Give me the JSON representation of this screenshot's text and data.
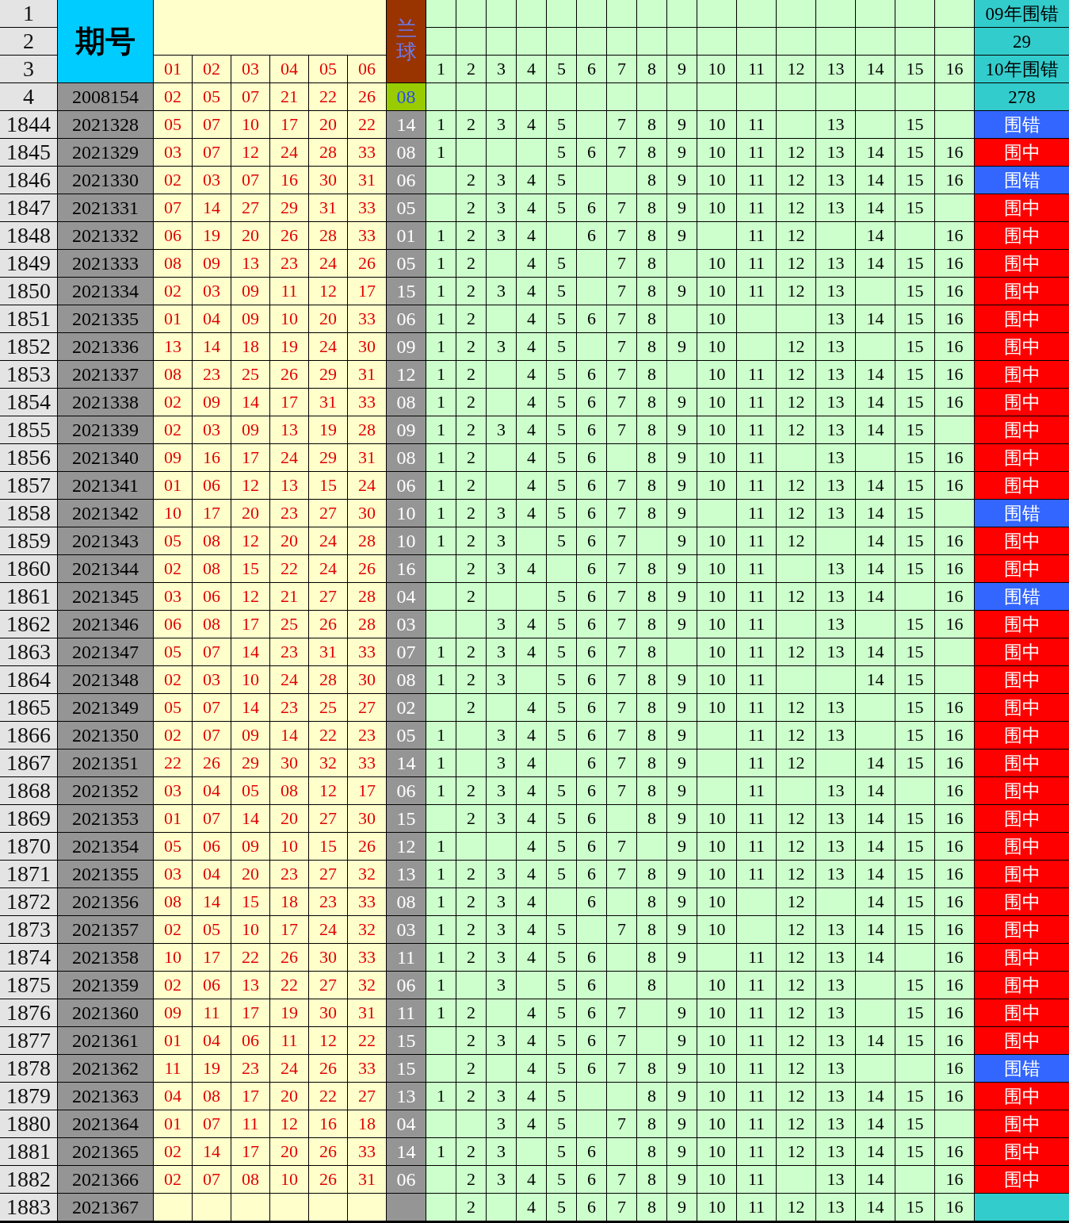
{
  "header": {
    "row_numbers": [
      "1",
      "2",
      "3"
    ],
    "issue_label": "期号",
    "red_columns": [
      "01",
      "02",
      "03",
      "04",
      "05",
      "06"
    ],
    "blue_label": "兰球",
    "number_columns": [
      "1",
      "2",
      "3",
      "4",
      "5",
      "6",
      "7",
      "8",
      "9",
      "10",
      "11",
      "12",
      "13",
      "14",
      "15",
      "16"
    ],
    "summary": [
      "09年围错",
      "29",
      "10年围错"
    ]
  },
  "rows": [
    {
      "kind": "reference",
      "row": "4",
      "issue": "2008154",
      "reds": [
        "02",
        "05",
        "07",
        "21",
        "22",
        "26"
      ],
      "blue": "08",
      "cells": [
        null,
        null,
        null,
        null,
        null,
        null,
        null,
        null,
        null,
        null,
        null,
        null,
        null,
        null,
        null,
        null
      ],
      "result": {
        "text": "278",
        "kind": "count"
      }
    },
    {
      "kind": "draw",
      "row": "1844",
      "issue": "2021328",
      "reds": [
        "05",
        "07",
        "10",
        "17",
        "20",
        "22"
      ],
      "blue": "14",
      "cells": [
        "1",
        "2",
        "3",
        "4",
        "5",
        null,
        "7",
        "8",
        "9",
        "10",
        "11",
        null,
        "13",
        null,
        "15",
        null
      ],
      "result": {
        "text": "围错",
        "kind": "miss"
      }
    },
    {
      "kind": "draw",
      "row": "1845",
      "issue": "2021329",
      "reds": [
        "03",
        "07",
        "12",
        "24",
        "28",
        "33"
      ],
      "blue": "08",
      "cells": [
        "1",
        null,
        null,
        null,
        "5",
        "6",
        "7",
        "8",
        "9",
        "10",
        "11",
        "12",
        "13",
        "14",
        "15",
        "16"
      ],
      "result": {
        "text": "围中",
        "kind": "hit"
      }
    },
    {
      "kind": "draw",
      "row": "1846",
      "issue": "2021330",
      "reds": [
        "02",
        "03",
        "07",
        "16",
        "30",
        "31"
      ],
      "blue": "06",
      "cells": [
        null,
        "2",
        "3",
        "4",
        "5",
        null,
        null,
        "8",
        "9",
        "10",
        "11",
        "12",
        "13",
        "14",
        "15",
        "16"
      ],
      "result": {
        "text": "围错",
        "kind": "miss"
      }
    },
    {
      "kind": "draw",
      "row": "1847",
      "issue": "2021331",
      "reds": [
        "07",
        "14",
        "27",
        "29",
        "31",
        "33"
      ],
      "blue": "05",
      "cells": [
        null,
        "2",
        "3",
        "4",
        "5",
        "6",
        "7",
        "8",
        "9",
        "10",
        "11",
        "12",
        "13",
        "14",
        "15",
        null
      ],
      "result": {
        "text": "围中",
        "kind": "hit"
      }
    },
    {
      "kind": "draw",
      "row": "1848",
      "issue": "2021332",
      "reds": [
        "06",
        "19",
        "20",
        "26",
        "28",
        "33"
      ],
      "blue": "01",
      "cells": [
        "1",
        "2",
        "3",
        "4",
        null,
        "6",
        "7",
        "8",
        "9",
        null,
        "11",
        "12",
        null,
        "14",
        null,
        "16"
      ],
      "result": {
        "text": "围中",
        "kind": "hit"
      }
    },
    {
      "kind": "draw",
      "row": "1849",
      "issue": "2021333",
      "reds": [
        "08",
        "09",
        "13",
        "23",
        "24",
        "26"
      ],
      "blue": "05",
      "cells": [
        "1",
        "2",
        null,
        "4",
        "5",
        null,
        "7",
        "8",
        null,
        "10",
        "11",
        "12",
        "13",
        "14",
        "15",
        "16"
      ],
      "result": {
        "text": "围中",
        "kind": "hit"
      }
    },
    {
      "kind": "draw",
      "row": "1850",
      "issue": "2021334",
      "reds": [
        "02",
        "03",
        "09",
        "11",
        "12",
        "17"
      ],
      "blue": "15",
      "cells": [
        "1",
        "2",
        "3",
        "4",
        "5",
        null,
        "7",
        "8",
        "9",
        "10",
        "11",
        "12",
        "13",
        null,
        "15",
        "16"
      ],
      "result": {
        "text": "围中",
        "kind": "hit"
      }
    },
    {
      "kind": "draw",
      "row": "1851",
      "issue": "2021335",
      "reds": [
        "01",
        "04",
        "09",
        "10",
        "20",
        "33"
      ],
      "blue": "06",
      "cells": [
        "1",
        "2",
        null,
        "4",
        "5",
        "6",
        "7",
        "8",
        null,
        "10",
        null,
        null,
        "13",
        "14",
        "15",
        "16"
      ],
      "result": {
        "text": "围中",
        "kind": "hit"
      }
    },
    {
      "kind": "draw",
      "row": "1852",
      "issue": "2021336",
      "reds": [
        "13",
        "14",
        "18",
        "19",
        "24",
        "30"
      ],
      "blue": "09",
      "cells": [
        "1",
        "2",
        "3",
        "4",
        "5",
        null,
        "7",
        "8",
        "9",
        "10",
        null,
        "12",
        "13",
        null,
        "15",
        "16"
      ],
      "result": {
        "text": "围中",
        "kind": "hit"
      }
    },
    {
      "kind": "draw",
      "row": "1853",
      "issue": "2021337",
      "reds": [
        "08",
        "23",
        "25",
        "26",
        "29",
        "31"
      ],
      "blue": "12",
      "cells": [
        "1",
        "2",
        null,
        "4",
        "5",
        "6",
        "7",
        "8",
        null,
        "10",
        "11",
        "12",
        "13",
        "14",
        "15",
        "16"
      ],
      "result": {
        "text": "围中",
        "kind": "hit"
      }
    },
    {
      "kind": "draw",
      "row": "1854",
      "issue": "2021338",
      "reds": [
        "02",
        "09",
        "14",
        "17",
        "31",
        "33"
      ],
      "blue": "08",
      "cells": [
        "1",
        "2",
        null,
        "4",
        "5",
        "6",
        "7",
        "8",
        "9",
        "10",
        "11",
        "12",
        "13",
        "14",
        "15",
        "16"
      ],
      "result": {
        "text": "围中",
        "kind": "hit"
      }
    },
    {
      "kind": "draw",
      "row": "1855",
      "issue": "2021339",
      "reds": [
        "02",
        "03",
        "09",
        "13",
        "19",
        "28"
      ],
      "blue": "09",
      "cells": [
        "1",
        "2",
        "3",
        "4",
        "5",
        "6",
        "7",
        "8",
        "9",
        "10",
        "11",
        "12",
        "13",
        "14",
        "15",
        null
      ],
      "result": {
        "text": "围中",
        "kind": "hit"
      }
    },
    {
      "kind": "draw",
      "row": "1856",
      "issue": "2021340",
      "reds": [
        "09",
        "16",
        "17",
        "24",
        "29",
        "31"
      ],
      "blue": "08",
      "cells": [
        "1",
        "2",
        null,
        "4",
        "5",
        "6",
        null,
        "8",
        "9",
        "10",
        "11",
        null,
        "13",
        null,
        "15",
        "16"
      ],
      "result": {
        "text": "围中",
        "kind": "hit"
      }
    },
    {
      "kind": "draw",
      "row": "1857",
      "issue": "2021341",
      "reds": [
        "01",
        "06",
        "12",
        "13",
        "15",
        "24"
      ],
      "blue": "06",
      "cells": [
        "1",
        "2",
        null,
        "4",
        "5",
        "6",
        "7",
        "8",
        "9",
        "10",
        "11",
        "12",
        "13",
        "14",
        "15",
        "16"
      ],
      "result": {
        "text": "围中",
        "kind": "hit"
      }
    },
    {
      "kind": "draw",
      "row": "1858",
      "issue": "2021342",
      "reds": [
        "10",
        "17",
        "20",
        "23",
        "27",
        "30"
      ],
      "blue": "10",
      "cells": [
        "1",
        "2",
        "3",
        "4",
        "5",
        "6",
        "7",
        "8",
        "9",
        null,
        "11",
        "12",
        "13",
        "14",
        "15",
        null
      ],
      "result": {
        "text": "围错",
        "kind": "miss"
      }
    },
    {
      "kind": "draw",
      "row": "1859",
      "issue": "2021343",
      "reds": [
        "05",
        "08",
        "12",
        "20",
        "24",
        "28"
      ],
      "blue": "10",
      "cells": [
        "1",
        "2",
        "3",
        null,
        "5",
        "6",
        "7",
        null,
        "9",
        "10",
        "11",
        "12",
        null,
        "14",
        "15",
        "16"
      ],
      "result": {
        "text": "围中",
        "kind": "hit"
      }
    },
    {
      "kind": "draw",
      "row": "1860",
      "issue": "2021344",
      "reds": [
        "02",
        "08",
        "15",
        "22",
        "24",
        "26"
      ],
      "blue": "16",
      "cells": [
        null,
        "2",
        "3",
        "4",
        null,
        "6",
        "7",
        "8",
        "9",
        "10",
        "11",
        null,
        "13",
        "14",
        "15",
        "16"
      ],
      "result": {
        "text": "围中",
        "kind": "hit"
      }
    },
    {
      "kind": "draw",
      "row": "1861",
      "issue": "2021345",
      "reds": [
        "03",
        "06",
        "12",
        "21",
        "27",
        "28"
      ],
      "blue": "04",
      "cells": [
        null,
        "2",
        null,
        null,
        "5",
        "6",
        "7",
        "8",
        "9",
        "10",
        "11",
        "12",
        "13",
        "14",
        null,
        "16"
      ],
      "result": {
        "text": "围错",
        "kind": "miss"
      }
    },
    {
      "kind": "draw",
      "row": "1862",
      "issue": "2021346",
      "reds": [
        "06",
        "08",
        "17",
        "25",
        "26",
        "28"
      ],
      "blue": "03",
      "cells": [
        null,
        null,
        "3",
        "4",
        "5",
        "6",
        "7",
        "8",
        "9",
        "10",
        "11",
        null,
        "13",
        null,
        "15",
        "16"
      ],
      "result": {
        "text": "围中",
        "kind": "hit"
      }
    },
    {
      "kind": "draw",
      "row": "1863",
      "issue": "2021347",
      "reds": [
        "05",
        "07",
        "14",
        "23",
        "31",
        "33"
      ],
      "blue": "07",
      "cells": [
        "1",
        "2",
        "3",
        "4",
        "5",
        "6",
        "7",
        "8",
        null,
        "10",
        "11",
        "12",
        "13",
        "14",
        "15",
        null
      ],
      "result": {
        "text": "围中",
        "kind": "hit"
      }
    },
    {
      "kind": "draw",
      "row": "1864",
      "issue": "2021348",
      "reds": [
        "02",
        "03",
        "10",
        "24",
        "28",
        "30"
      ],
      "blue": "08",
      "cells": [
        "1",
        "2",
        "3",
        null,
        "5",
        "6",
        "7",
        "8",
        "9",
        "10",
        "11",
        null,
        null,
        "14",
        "15",
        null
      ],
      "result": {
        "text": "围中",
        "kind": "hit"
      }
    },
    {
      "kind": "draw",
      "row": "1865",
      "issue": "2021349",
      "reds": [
        "05",
        "07",
        "14",
        "23",
        "25",
        "27"
      ],
      "blue": "02",
      "cells": [
        null,
        "2",
        null,
        "4",
        "5",
        "6",
        "7",
        "8",
        "9",
        "10",
        "11",
        "12",
        "13",
        null,
        "15",
        "16"
      ],
      "result": {
        "text": "围中",
        "kind": "hit"
      }
    },
    {
      "kind": "draw",
      "row": "1866",
      "issue": "2021350",
      "reds": [
        "02",
        "07",
        "09",
        "14",
        "22",
        "23"
      ],
      "blue": "05",
      "cells": [
        "1",
        null,
        "3",
        "4",
        "5",
        "6",
        "7",
        "8",
        "9",
        null,
        "11",
        "12",
        "13",
        null,
        "15",
        "16"
      ],
      "result": {
        "text": "围中",
        "kind": "hit"
      }
    },
    {
      "kind": "draw",
      "row": "1867",
      "issue": "2021351",
      "reds": [
        "22",
        "26",
        "29",
        "30",
        "32",
        "33"
      ],
      "blue": "14",
      "cells": [
        "1",
        null,
        "3",
        "4",
        null,
        "6",
        "7",
        "8",
        "9",
        null,
        "11",
        "12",
        null,
        "14",
        "15",
        "16"
      ],
      "result": {
        "text": "围中",
        "kind": "hit"
      }
    },
    {
      "kind": "draw",
      "row": "1868",
      "issue": "2021352",
      "reds": [
        "03",
        "04",
        "05",
        "08",
        "12",
        "17"
      ],
      "blue": "06",
      "cells": [
        "1",
        "2",
        "3",
        "4",
        "5",
        "6",
        "7",
        "8",
        "9",
        null,
        "11",
        null,
        "13",
        "14",
        null,
        "16"
      ],
      "result": {
        "text": "围中",
        "kind": "hit"
      }
    },
    {
      "kind": "draw",
      "row": "1869",
      "issue": "2021353",
      "reds": [
        "01",
        "07",
        "14",
        "20",
        "27",
        "30"
      ],
      "blue": "15",
      "cells": [
        null,
        "2",
        "3",
        "4",
        "5",
        "6",
        null,
        "8",
        "9",
        "10",
        "11",
        "12",
        "13",
        "14",
        "15",
        "16"
      ],
      "result": {
        "text": "围中",
        "kind": "hit"
      }
    },
    {
      "kind": "draw",
      "row": "1870",
      "issue": "2021354",
      "reds": [
        "05",
        "06",
        "09",
        "10",
        "15",
        "26"
      ],
      "blue": "12",
      "cells": [
        "1",
        null,
        null,
        "4",
        "5",
        "6",
        "7",
        null,
        "9",
        "10",
        "11",
        "12",
        "13",
        "14",
        "15",
        "16"
      ],
      "result": {
        "text": "围中",
        "kind": "hit"
      }
    },
    {
      "kind": "draw",
      "row": "1871",
      "issue": "2021355",
      "reds": [
        "03",
        "04",
        "20",
        "23",
        "27",
        "32"
      ],
      "blue": "13",
      "cells": [
        "1",
        "2",
        "3",
        "4",
        "5",
        "6",
        "7",
        "8",
        "9",
        "10",
        "11",
        "12",
        "13",
        "14",
        "15",
        "16"
      ],
      "result": {
        "text": "围中",
        "kind": "hit"
      }
    },
    {
      "kind": "draw",
      "row": "1872",
      "issue": "2021356",
      "reds": [
        "08",
        "14",
        "15",
        "18",
        "23",
        "33"
      ],
      "blue": "08",
      "cells": [
        "1",
        "2",
        "3",
        "4",
        null,
        "6",
        null,
        "8",
        "9",
        "10",
        null,
        "12",
        null,
        "14",
        "15",
        "16"
      ],
      "result": {
        "text": "围中",
        "kind": "hit"
      }
    },
    {
      "kind": "draw",
      "row": "1873",
      "issue": "2021357",
      "reds": [
        "02",
        "05",
        "10",
        "17",
        "24",
        "32"
      ],
      "blue": "03",
      "cells": [
        "1",
        "2",
        "3",
        "4",
        "5",
        null,
        "7",
        "8",
        "9",
        "10",
        null,
        "12",
        "13",
        "14",
        "15",
        "16"
      ],
      "result": {
        "text": "围中",
        "kind": "hit"
      }
    },
    {
      "kind": "draw",
      "row": "1874",
      "issue": "2021358",
      "reds": [
        "10",
        "17",
        "22",
        "26",
        "30",
        "33"
      ],
      "blue": "11",
      "cells": [
        "1",
        "2",
        "3",
        "4",
        "5",
        "6",
        null,
        "8",
        "9",
        null,
        "11",
        "12",
        "13",
        "14",
        null,
        "16"
      ],
      "result": {
        "text": "围中",
        "kind": "hit"
      }
    },
    {
      "kind": "draw",
      "row": "1875",
      "issue": "2021359",
      "reds": [
        "02",
        "06",
        "13",
        "22",
        "27",
        "32"
      ],
      "blue": "06",
      "cells": [
        "1",
        null,
        "3",
        null,
        "5",
        "6",
        null,
        "8",
        null,
        "10",
        "11",
        "12",
        "13",
        null,
        "15",
        "16"
      ],
      "result": {
        "text": "围中",
        "kind": "hit"
      }
    },
    {
      "kind": "draw",
      "row": "1876",
      "issue": "2021360",
      "reds": [
        "09",
        "11",
        "17",
        "19",
        "30",
        "31"
      ],
      "blue": "11",
      "cells": [
        "1",
        "2",
        null,
        "4",
        "5",
        "6",
        "7",
        null,
        "9",
        "10",
        "11",
        "12",
        "13",
        null,
        "15",
        "16"
      ],
      "result": {
        "text": "围中",
        "kind": "hit"
      }
    },
    {
      "kind": "draw",
      "row": "1877",
      "issue": "2021361",
      "reds": [
        "01",
        "04",
        "06",
        "11",
        "12",
        "22"
      ],
      "blue": "15",
      "cells": [
        null,
        "2",
        "3",
        "4",
        "5",
        "6",
        "7",
        null,
        "9",
        "10",
        "11",
        "12",
        "13",
        "14",
        "15",
        "16"
      ],
      "result": {
        "text": "围中",
        "kind": "hit"
      }
    },
    {
      "kind": "draw",
      "row": "1878",
      "issue": "2021362",
      "reds": [
        "11",
        "19",
        "23",
        "24",
        "26",
        "33"
      ],
      "blue": "15",
      "cells": [
        null,
        "2",
        null,
        "4",
        "5",
        "6",
        "7",
        "8",
        "9",
        "10",
        "11",
        "12",
        "13",
        null,
        null,
        "16"
      ],
      "result": {
        "text": "围错",
        "kind": "miss"
      }
    },
    {
      "kind": "draw",
      "row": "1879",
      "issue": "2021363",
      "reds": [
        "04",
        "08",
        "17",
        "20",
        "22",
        "27"
      ],
      "blue": "13",
      "cells": [
        "1",
        "2",
        "3",
        "4",
        "5",
        null,
        null,
        "8",
        "9",
        "10",
        "11",
        "12",
        "13",
        "14",
        "15",
        "16"
      ],
      "result": {
        "text": "围中",
        "kind": "hit"
      }
    },
    {
      "kind": "draw",
      "row": "1880",
      "issue": "2021364",
      "reds": [
        "01",
        "07",
        "11",
        "12",
        "16",
        "18"
      ],
      "blue": "04",
      "cells": [
        null,
        null,
        "3",
        "4",
        "5",
        null,
        "7",
        "8",
        "9",
        "10",
        "11",
        "12",
        "13",
        "14",
        "15",
        null
      ],
      "result": {
        "text": "围中",
        "kind": "hit"
      }
    },
    {
      "kind": "draw",
      "row": "1881",
      "issue": "2021365",
      "reds": [
        "02",
        "14",
        "17",
        "20",
        "26",
        "33"
      ],
      "blue": "14",
      "cells": [
        "1",
        "2",
        "3",
        null,
        "5",
        "6",
        null,
        "8",
        "9",
        "10",
        "11",
        "12",
        "13",
        "14",
        "15",
        "16"
      ],
      "result": {
        "text": "围中",
        "kind": "hit"
      }
    },
    {
      "kind": "draw",
      "row": "1882",
      "issue": "2021366",
      "reds": [
        "02",
        "07",
        "08",
        "10",
        "26",
        "31"
      ],
      "blue": "06",
      "cells": [
        null,
        "2",
        "3",
        "4",
        "5",
        "6",
        "7",
        "8",
        "9",
        "10",
        "11",
        null,
        "13",
        "14",
        null,
        "16"
      ],
      "result": {
        "text": "围中",
        "kind": "hit"
      }
    },
    {
      "kind": "draw",
      "row": "1883",
      "issue": "2021367",
      "cells": [
        null,
        "2",
        null,
        "4",
        "5",
        "6",
        "7",
        "8",
        "9",
        "10",
        "11",
        "12",
        "13",
        "14",
        "15",
        "16"
      ]
    }
  ]
}
